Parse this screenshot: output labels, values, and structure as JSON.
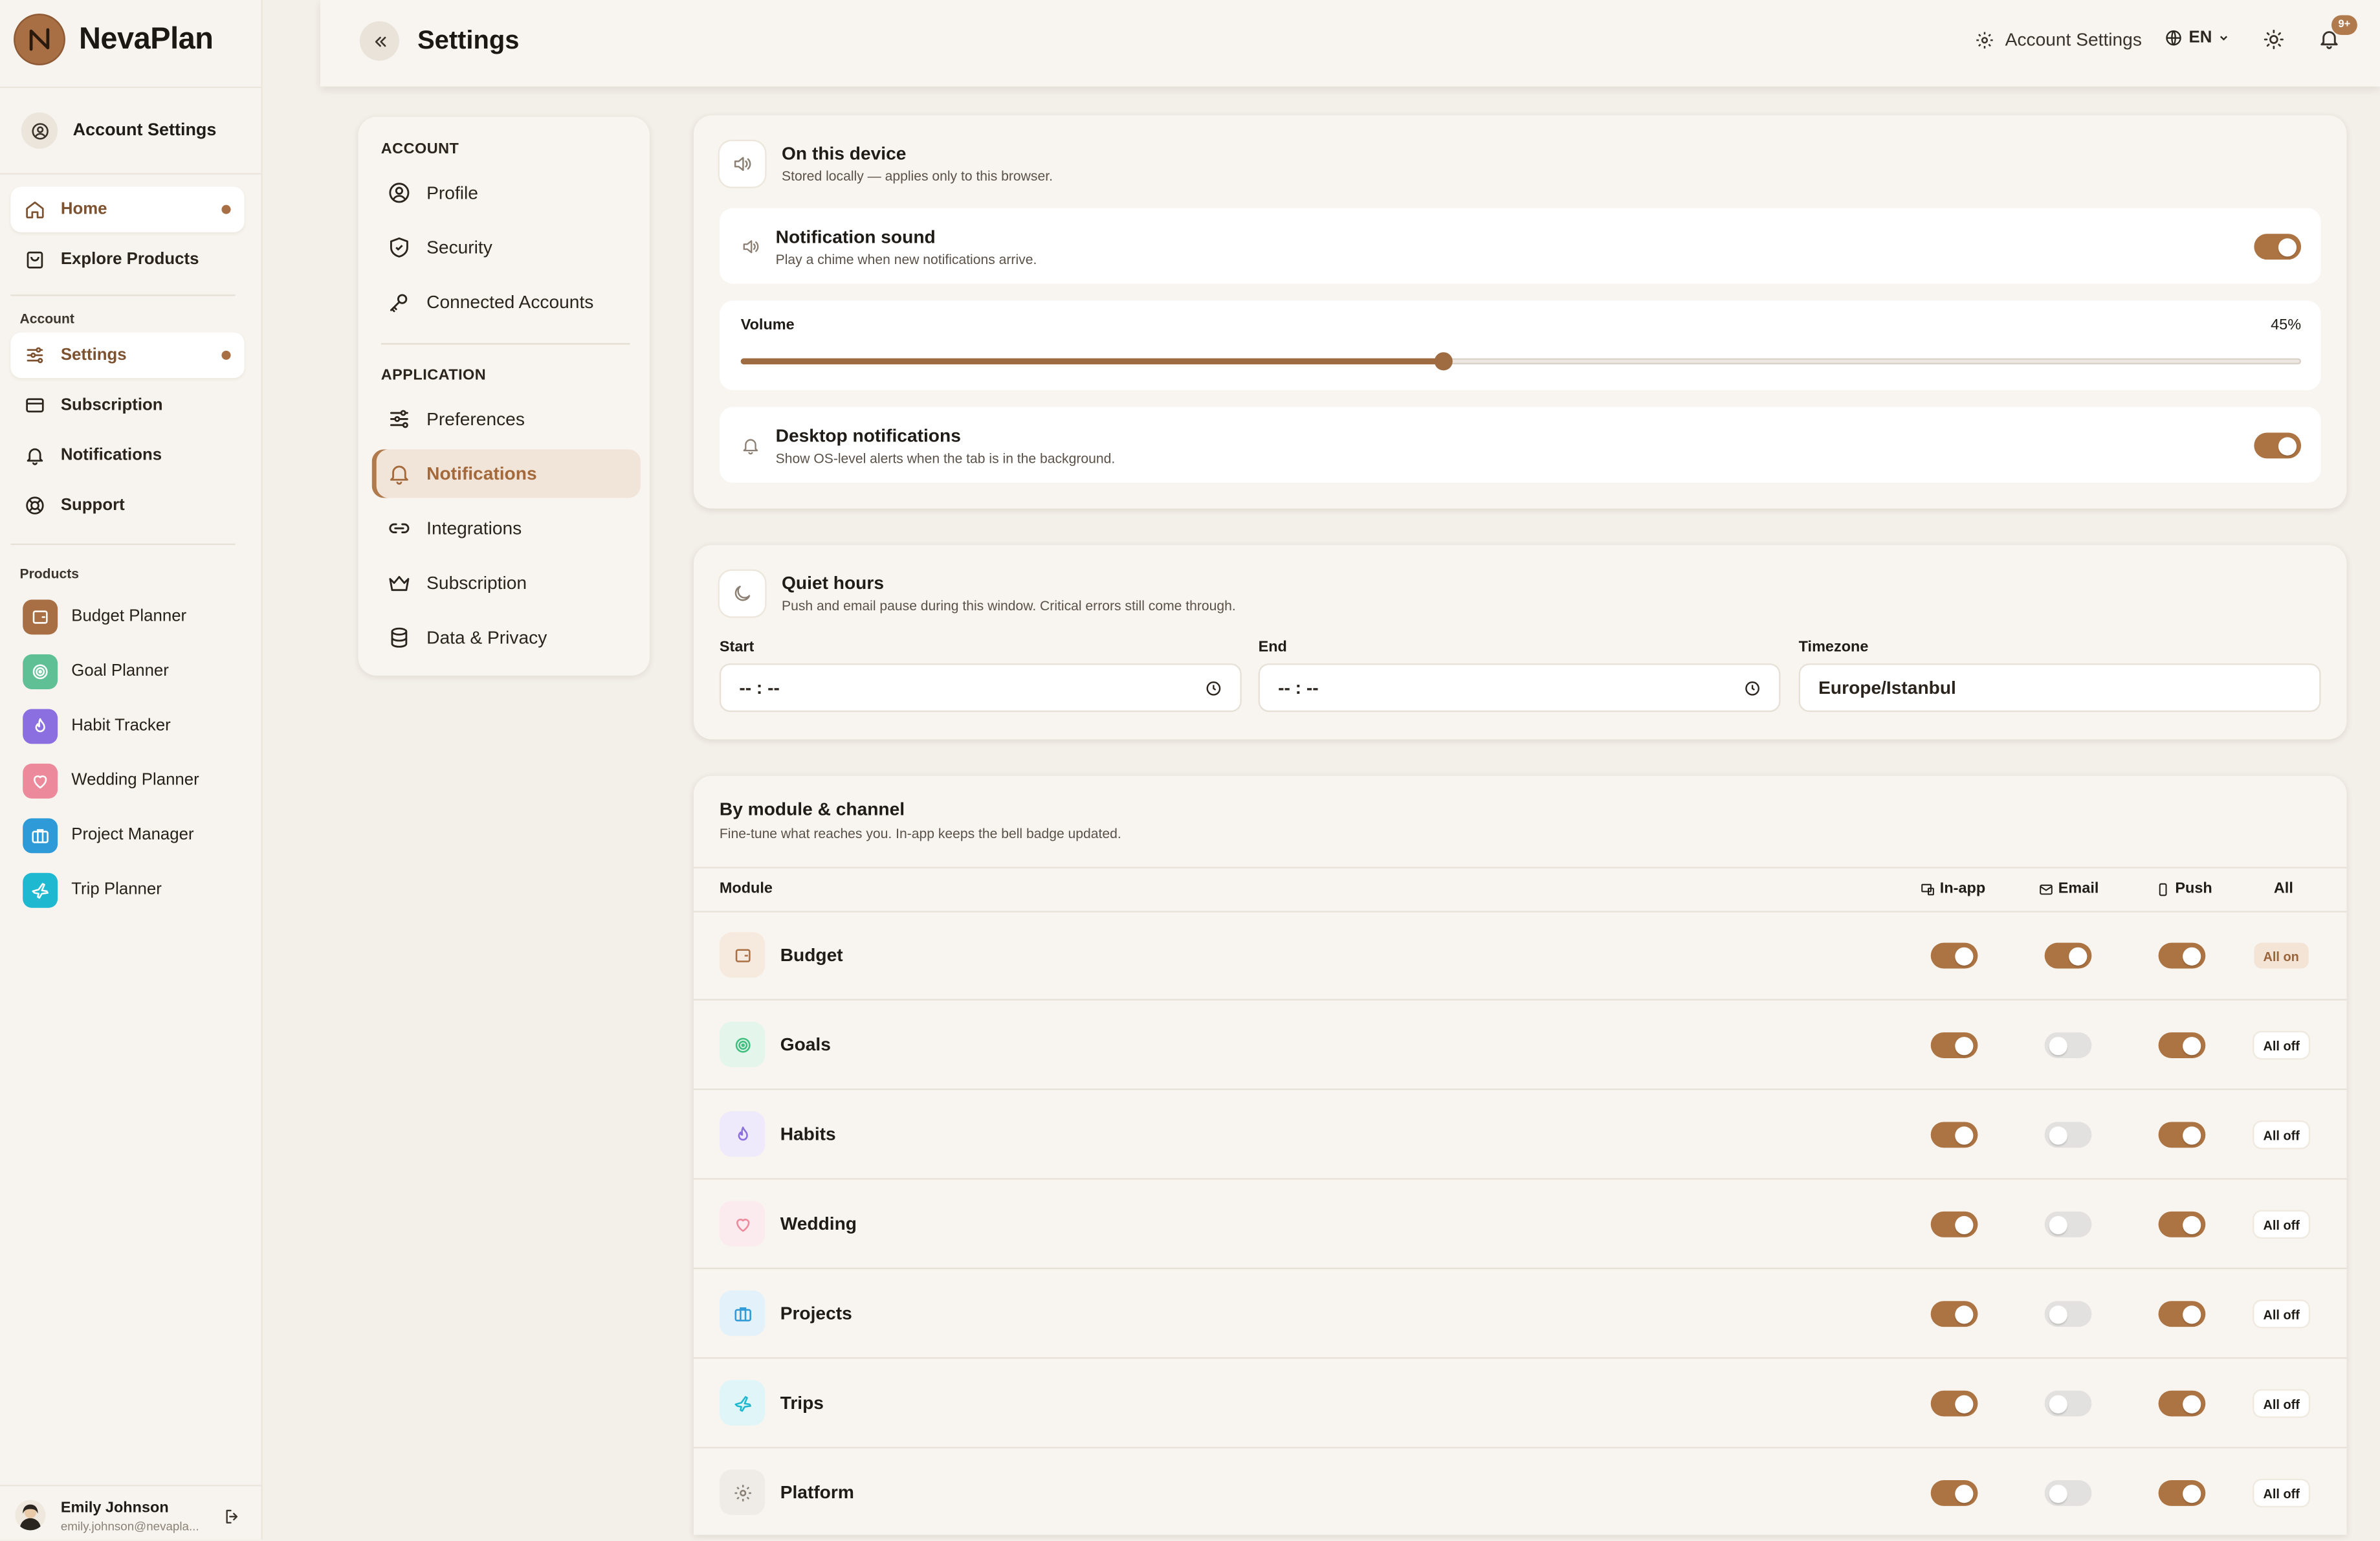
{
  "app": {
    "name": "NevaPlan"
  },
  "sidebar": {
    "account_settings_label": "Account Settings",
    "main_items": [
      {
        "label": "Home",
        "icon": "home-icon",
        "active": true
      },
      {
        "label": "Explore Products",
        "icon": "bag-icon",
        "active": false
      }
    ],
    "account_section_label": "Account",
    "account_items": [
      {
        "label": "Settings",
        "icon": "sliders-icon",
        "active": true
      },
      {
        "label": "Subscription",
        "icon": "card-icon",
        "active": false
      },
      {
        "label": "Notifications",
        "icon": "bell-icon",
        "active": false
      },
      {
        "label": "Support",
        "icon": "lifebuoy-icon",
        "active": false
      }
    ],
    "products_section_label": "Products",
    "products": [
      {
        "label": "Budget Planner",
        "icon": "wallet-icon",
        "color": "#a96f44"
      },
      {
        "label": "Goal Planner",
        "icon": "target-icon",
        "color": "#5fbf95"
      },
      {
        "label": "Habit Tracker",
        "icon": "flame-icon",
        "color": "#8b6fe0"
      },
      {
        "label": "Wedding Planner",
        "icon": "heart-icon",
        "color": "#ec8a9c"
      },
      {
        "label": "Project Manager",
        "icon": "briefcase-icon",
        "color": "#2e9ad8"
      },
      {
        "label": "Trip Planner",
        "icon": "plane-icon",
        "color": "#1eb8d0"
      }
    ],
    "user": {
      "name": "Emily Johnson",
      "email": "emily.johnson@nevapla..."
    }
  },
  "header": {
    "title": "Settings",
    "account_settings_label": "Account Settings",
    "language": "EN",
    "notification_badge": "9+"
  },
  "settings_nav": {
    "account_heading": "ACCOUNT",
    "account_items": [
      {
        "label": "Profile",
        "icon": "user-circle-icon"
      },
      {
        "label": "Security",
        "icon": "shield-icon"
      },
      {
        "label": "Connected Accounts",
        "icon": "key-icon"
      }
    ],
    "application_heading": "APPLICATION",
    "application_items": [
      {
        "label": "Preferences",
        "icon": "sliders-icon",
        "active": false
      },
      {
        "label": "Notifications",
        "icon": "bell-icon",
        "active": true
      },
      {
        "label": "Integrations",
        "icon": "link-icon",
        "active": false
      },
      {
        "label": "Subscription",
        "icon": "crown-icon",
        "active": false
      },
      {
        "label": "Data & Privacy",
        "icon": "database-icon",
        "active": false
      }
    ]
  },
  "device": {
    "title": "On this device",
    "subtitle": "Stored locally — applies only to this browser.",
    "sound": {
      "title": "Notification sound",
      "subtitle": "Play a chime when new notifications arrive.",
      "enabled": true
    },
    "volume": {
      "label": "Volume",
      "value_text": "45%",
      "value": 0.45
    },
    "desktop": {
      "title": "Desktop notifications",
      "subtitle": "Show OS-level alerts when the tab is in the background.",
      "enabled": true
    }
  },
  "quiet_hours": {
    "title": "Quiet hours",
    "subtitle": "Push and email pause during this window. Critical errors still come through.",
    "start_label": "Start",
    "start_value": "-- : --",
    "end_label": "End",
    "end_value": "-- : --",
    "timezone_label": "Timezone",
    "timezone_value": "Europe/Istanbul"
  },
  "modules": {
    "title": "By module & channel",
    "subtitle": "Fine-tune what reaches you. In-app keeps the bell badge updated.",
    "columns": {
      "module": "Module",
      "inapp": "In-app",
      "email": "Email",
      "push": "Push",
      "all": "All"
    },
    "rows": [
      {
        "name": "Budget",
        "icon": "wallet-icon",
        "color": "#a96f44",
        "bg": "#f6e9dd",
        "inapp": true,
        "email": true,
        "push": true,
        "all": "All on"
      },
      {
        "name": "Goals",
        "icon": "target-icon",
        "color": "#3fbf7f",
        "bg": "#e4f5eb",
        "inapp": true,
        "email": false,
        "push": true,
        "all": "All off"
      },
      {
        "name": "Habits",
        "icon": "flame-icon",
        "color": "#8b6fe0",
        "bg": "#eee9fb",
        "inapp": true,
        "email": false,
        "push": true,
        "all": "All off"
      },
      {
        "name": "Wedding",
        "icon": "heart-icon",
        "color": "#ec8a9c",
        "bg": "#fbeaee",
        "inapp": true,
        "email": false,
        "push": true,
        "all": "All off"
      },
      {
        "name": "Projects",
        "icon": "briefcase-icon",
        "color": "#2e9ad8",
        "bg": "#e3f1fa",
        "inapp": true,
        "email": false,
        "push": true,
        "all": "All off"
      },
      {
        "name": "Trips",
        "icon": "plane-icon",
        "color": "#1eb8d0",
        "bg": "#e0f5f8",
        "inapp": true,
        "email": false,
        "push": true,
        "all": "All off"
      },
      {
        "name": "Platform",
        "icon": "gear-icon",
        "color": "#8a8176",
        "bg": "#efece8",
        "inapp": true,
        "email": false,
        "push": true,
        "all": "All off"
      }
    ]
  }
}
